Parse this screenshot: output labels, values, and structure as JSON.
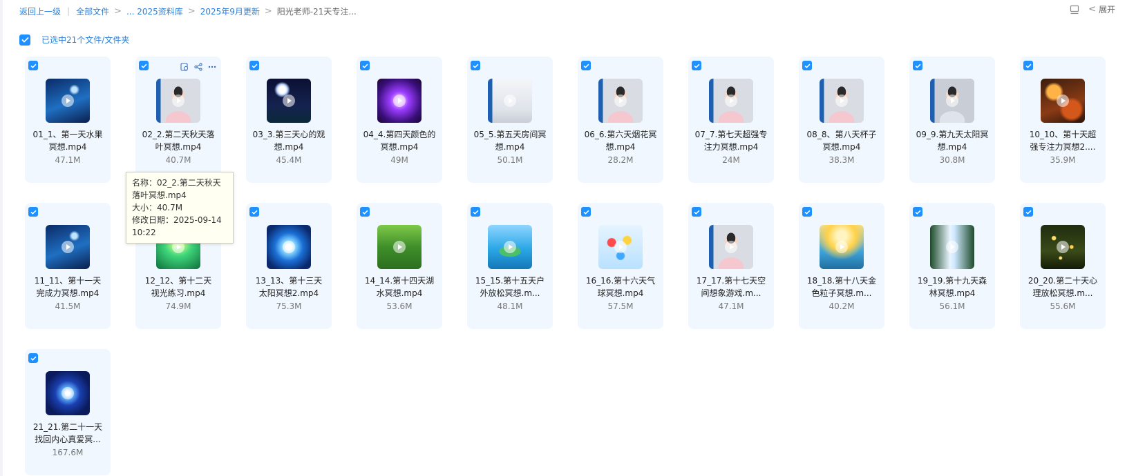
{
  "breadcrumb": {
    "back": "返回上一级",
    "all_files": "全部文件",
    "ellipsis_library": "... 2025资料库",
    "month_update": "2025年9月更新",
    "current": "阳光老师-21天专注..."
  },
  "top_right": {
    "expand_label": "展开"
  },
  "selection": {
    "text": "已选中21个文件/文件夹"
  },
  "accent_color": "#1e90ff",
  "files": [
    {
      "name": "01_1、第一天水果冥想.mp4",
      "size": "47.1M",
      "thumb": "night-lake"
    },
    {
      "name": "02_2.第二天秋天落叶冥想.mp4",
      "size": "40.7M",
      "thumb": "teacher"
    },
    {
      "name": "03_3.第三天心的观想.mp4",
      "size": "45.4M",
      "thumb": "moon-night"
    },
    {
      "name": "04_4.第四天颜色的冥想.mp4",
      "size": "49M",
      "thumb": "purple-galaxy"
    },
    {
      "name": "05_5.第五天房间冥想.mp4",
      "size": "50.1M",
      "thumb": "white-room"
    },
    {
      "name": "06_6.第六天烟花冥想.mp4",
      "size": "28.2M",
      "thumb": "teacher"
    },
    {
      "name": "07_7.第七天超强专注力冥想.mp4",
      "size": "24M",
      "thumb": "teacher"
    },
    {
      "name": "08_8、第八天杯子冥想.mp4",
      "size": "38.3M",
      "thumb": "teacher"
    },
    {
      "name": "09_9.第九天太阳冥想.mp4",
      "size": "30.8M",
      "thumb": "teacher-eyes-closed"
    },
    {
      "name": "10_10、第十天超强专注力冥想2....",
      "size": "35.9M",
      "thumb": "food"
    },
    {
      "name": "11_11、第十一天完成力冥想.mp4",
      "size": "41.5M",
      "thumb": "night-lake"
    },
    {
      "name": "12_12、第十二天视光练习.mp4",
      "size": "74.9M",
      "thumb": "green-light"
    },
    {
      "name": "13_13、第十三天太阳冥想2.mp4",
      "size": "75.3M",
      "thumb": "blue-orb"
    },
    {
      "name": "14_14.第十四天湖水冥想.mp4",
      "size": "53.6M",
      "thumb": "green-lake"
    },
    {
      "name": "15_15.第十五天户外放松冥想.m...",
      "size": "48.1M",
      "thumb": "island"
    },
    {
      "name": "16_16.第十六天气球冥想.mp4",
      "size": "57.5M",
      "thumb": "balloons"
    },
    {
      "name": "17_17.第十七天空间想象游戏.m...",
      "size": "47.1M",
      "thumb": "teacher"
    },
    {
      "name": "18_18.第十八天金色粒子冥想.m...",
      "size": "40.2M",
      "thumb": "golden-waterfall"
    },
    {
      "name": "19_19.第十九天森林冥想.mp4",
      "size": "56.1M",
      "thumb": "waterfall"
    },
    {
      "name": "20_20.第二十天心理放松冥想.m...",
      "size": "55.6M",
      "thumb": "fireflies"
    },
    {
      "name": "21_21.第二十一天找回内心真爱冥...",
      "size": "167.6M",
      "thumb": "blue-mandala"
    }
  ],
  "tooltip": {
    "name_line": "名称：02_2.第二天秋天落叶冥想.mp4",
    "size_line": "大小：40.7M",
    "date_line": "修改日期：2025-09-14 10:22"
  }
}
